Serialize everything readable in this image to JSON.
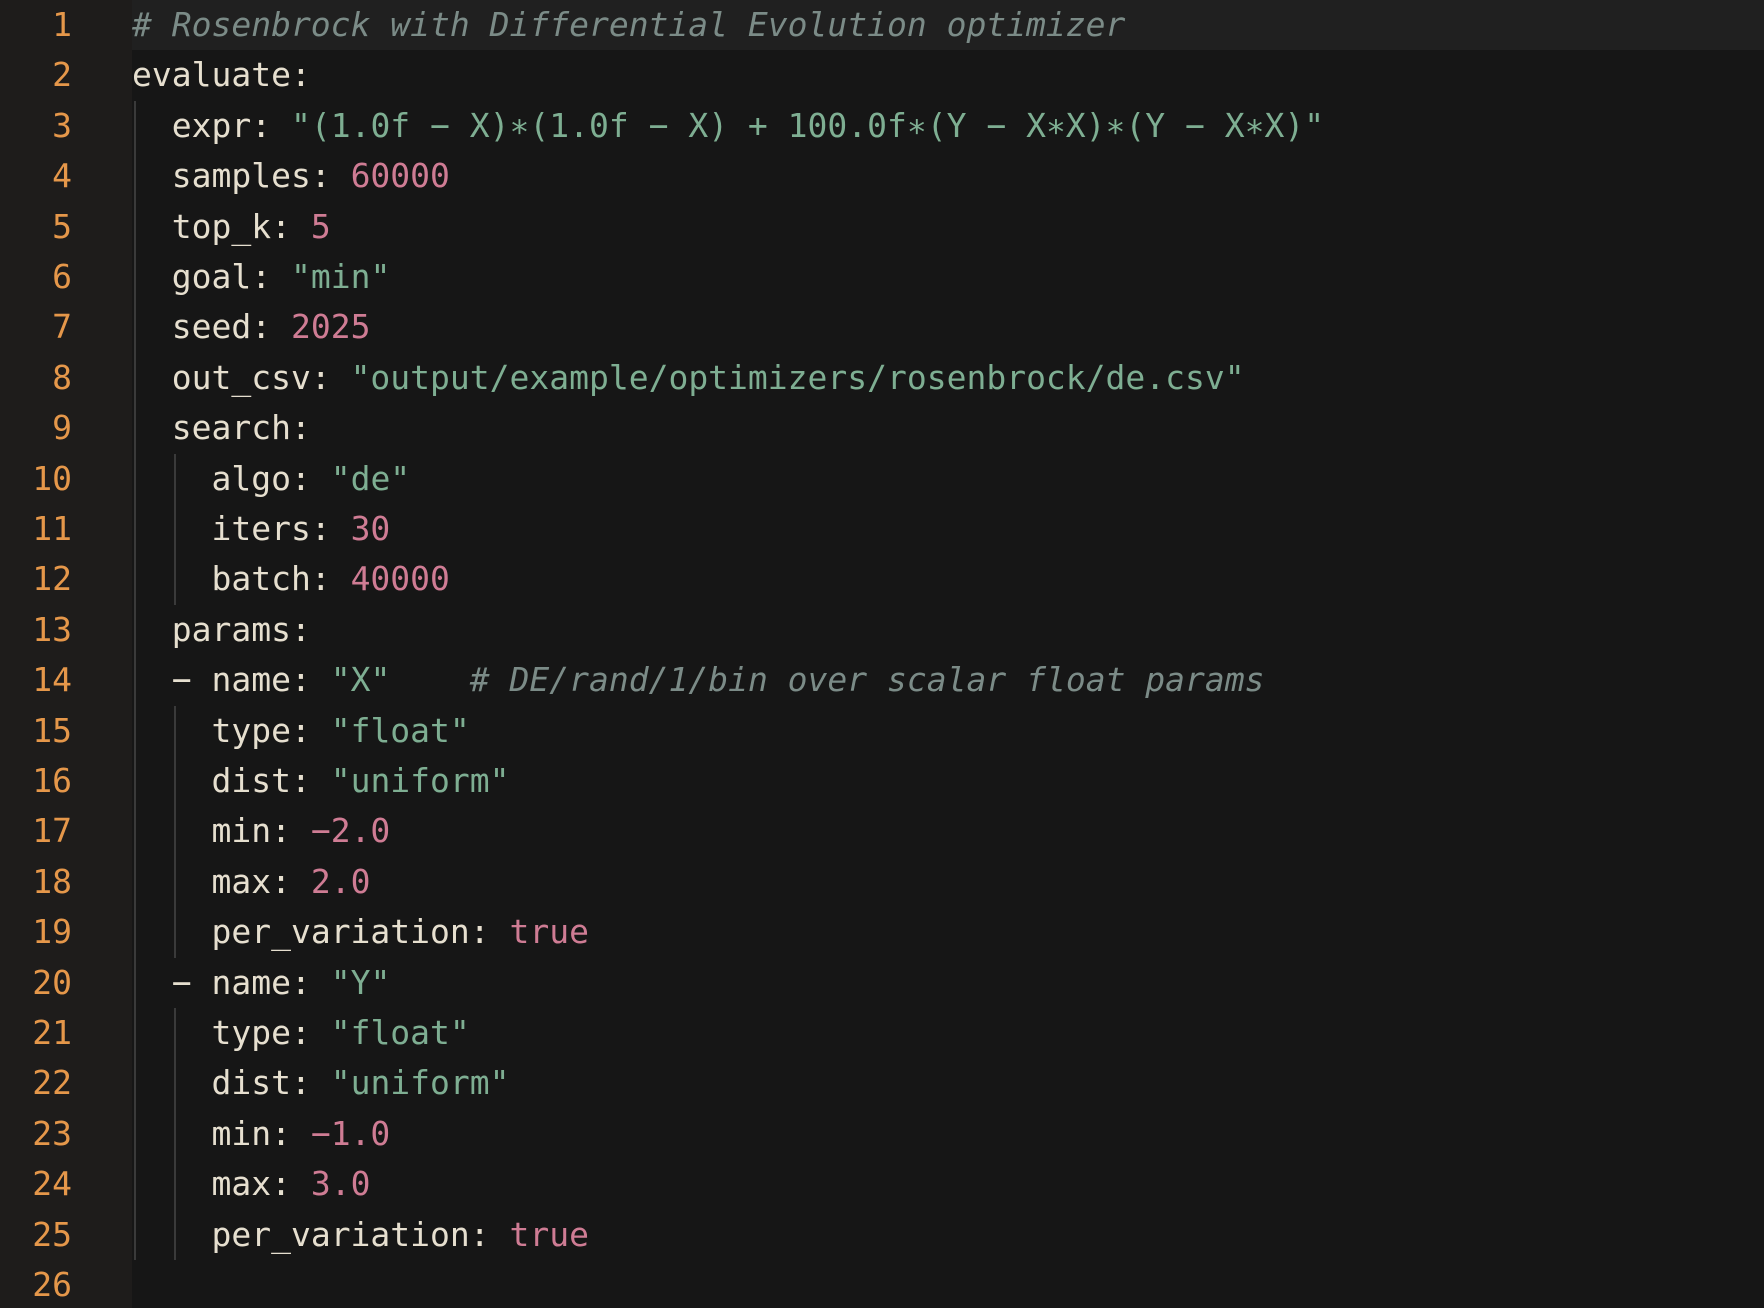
{
  "editor": {
    "lines": [
      {
        "n": "1",
        "indent": 0,
        "tokens": [
          {
            "t": "# Rosenbrock with Differential Evolution optimizer",
            "c": "comment"
          }
        ]
      },
      {
        "n": "2",
        "indent": 0,
        "tokens": [
          {
            "t": "evaluate:",
            "c": "key"
          }
        ]
      },
      {
        "n": "3",
        "indent": 2,
        "tokens": [
          {
            "t": "expr: ",
            "c": "key"
          },
          {
            "t": "\"(1.0f − X)∗(1.0f − X) + 100.0f∗(Y − X∗X)∗(Y − X∗X)\"",
            "c": "string"
          }
        ]
      },
      {
        "n": "4",
        "indent": 2,
        "tokens": [
          {
            "t": "samples: ",
            "c": "key"
          },
          {
            "t": "60000",
            "c": "number"
          }
        ]
      },
      {
        "n": "5",
        "indent": 2,
        "tokens": [
          {
            "t": "top_k: ",
            "c": "key"
          },
          {
            "t": "5",
            "c": "number"
          }
        ]
      },
      {
        "n": "6",
        "indent": 2,
        "tokens": [
          {
            "t": "goal: ",
            "c": "key"
          },
          {
            "t": "\"min\"",
            "c": "string"
          }
        ]
      },
      {
        "n": "7",
        "indent": 2,
        "tokens": [
          {
            "t": "seed: ",
            "c": "key"
          },
          {
            "t": "2025",
            "c": "number"
          }
        ]
      },
      {
        "n": "8",
        "indent": 2,
        "tokens": [
          {
            "t": "out_csv: ",
            "c": "key"
          },
          {
            "t": "\"output/example/optimizers/rosenbrock/de.csv\"",
            "c": "string"
          }
        ]
      },
      {
        "n": "9",
        "indent": 2,
        "tokens": [
          {
            "t": "search:",
            "c": "key"
          }
        ]
      },
      {
        "n": "10",
        "indent": 4,
        "tokens": [
          {
            "t": "algo: ",
            "c": "key"
          },
          {
            "t": "\"de\"",
            "c": "string"
          }
        ]
      },
      {
        "n": "11",
        "indent": 4,
        "tokens": [
          {
            "t": "iters: ",
            "c": "key"
          },
          {
            "t": "30",
            "c": "number"
          }
        ]
      },
      {
        "n": "12",
        "indent": 4,
        "tokens": [
          {
            "t": "batch: ",
            "c": "key"
          },
          {
            "t": "40000",
            "c": "number"
          }
        ]
      },
      {
        "n": "13",
        "indent": 2,
        "tokens": [
          {
            "t": "params:",
            "c": "key"
          }
        ]
      },
      {
        "n": "14",
        "indent": 2,
        "tokens": [
          {
            "t": "− name: ",
            "c": "key"
          },
          {
            "t": "\"X\"",
            "c": "string"
          },
          {
            "t": "    ",
            "c": "punct"
          },
          {
            "t": "# DE/rand/1/bin over scalar float params",
            "c": "comment"
          }
        ]
      },
      {
        "n": "15",
        "indent": 4,
        "tokens": [
          {
            "t": "type: ",
            "c": "key"
          },
          {
            "t": "\"float\"",
            "c": "string"
          }
        ]
      },
      {
        "n": "16",
        "indent": 4,
        "tokens": [
          {
            "t": "dist: ",
            "c": "key"
          },
          {
            "t": "\"uniform\"",
            "c": "string"
          }
        ]
      },
      {
        "n": "17",
        "indent": 4,
        "tokens": [
          {
            "t": "min: ",
            "c": "key"
          },
          {
            "t": "−2.0",
            "c": "number"
          }
        ]
      },
      {
        "n": "18",
        "indent": 4,
        "tokens": [
          {
            "t": "max: ",
            "c": "key"
          },
          {
            "t": "2.0",
            "c": "number"
          }
        ]
      },
      {
        "n": "19",
        "indent": 4,
        "tokens": [
          {
            "t": "per_variation: ",
            "c": "key"
          },
          {
            "t": "true",
            "c": "bool"
          }
        ]
      },
      {
        "n": "20",
        "indent": 2,
        "tokens": [
          {
            "t": "− name: ",
            "c": "key"
          },
          {
            "t": "\"Y\"",
            "c": "string"
          }
        ]
      },
      {
        "n": "21",
        "indent": 4,
        "tokens": [
          {
            "t": "type: ",
            "c": "key"
          },
          {
            "t": "\"float\"",
            "c": "string"
          }
        ]
      },
      {
        "n": "22",
        "indent": 4,
        "tokens": [
          {
            "t": "dist: ",
            "c": "key"
          },
          {
            "t": "\"uniform\"",
            "c": "string"
          }
        ]
      },
      {
        "n": "23",
        "indent": 4,
        "tokens": [
          {
            "t": "min: ",
            "c": "key"
          },
          {
            "t": "−1.0",
            "c": "number"
          }
        ]
      },
      {
        "n": "24",
        "indent": 4,
        "tokens": [
          {
            "t": "max: ",
            "c": "key"
          },
          {
            "t": "3.0",
            "c": "number"
          }
        ]
      },
      {
        "n": "25",
        "indent": 4,
        "tokens": [
          {
            "t": "per_variation: ",
            "c": "key"
          },
          {
            "t": "true",
            "c": "bool"
          }
        ]
      },
      {
        "n": "26",
        "indent": 0,
        "tokens": []
      }
    ],
    "current_line": "1",
    "colors": {
      "background": "#161616",
      "gutter": "#1e1c1b",
      "line_number": "#e5974a",
      "comment": "#7b8b87",
      "key": "#e6dfcf",
      "string": "#7eae92",
      "number": "#cf7c94"
    }
  }
}
